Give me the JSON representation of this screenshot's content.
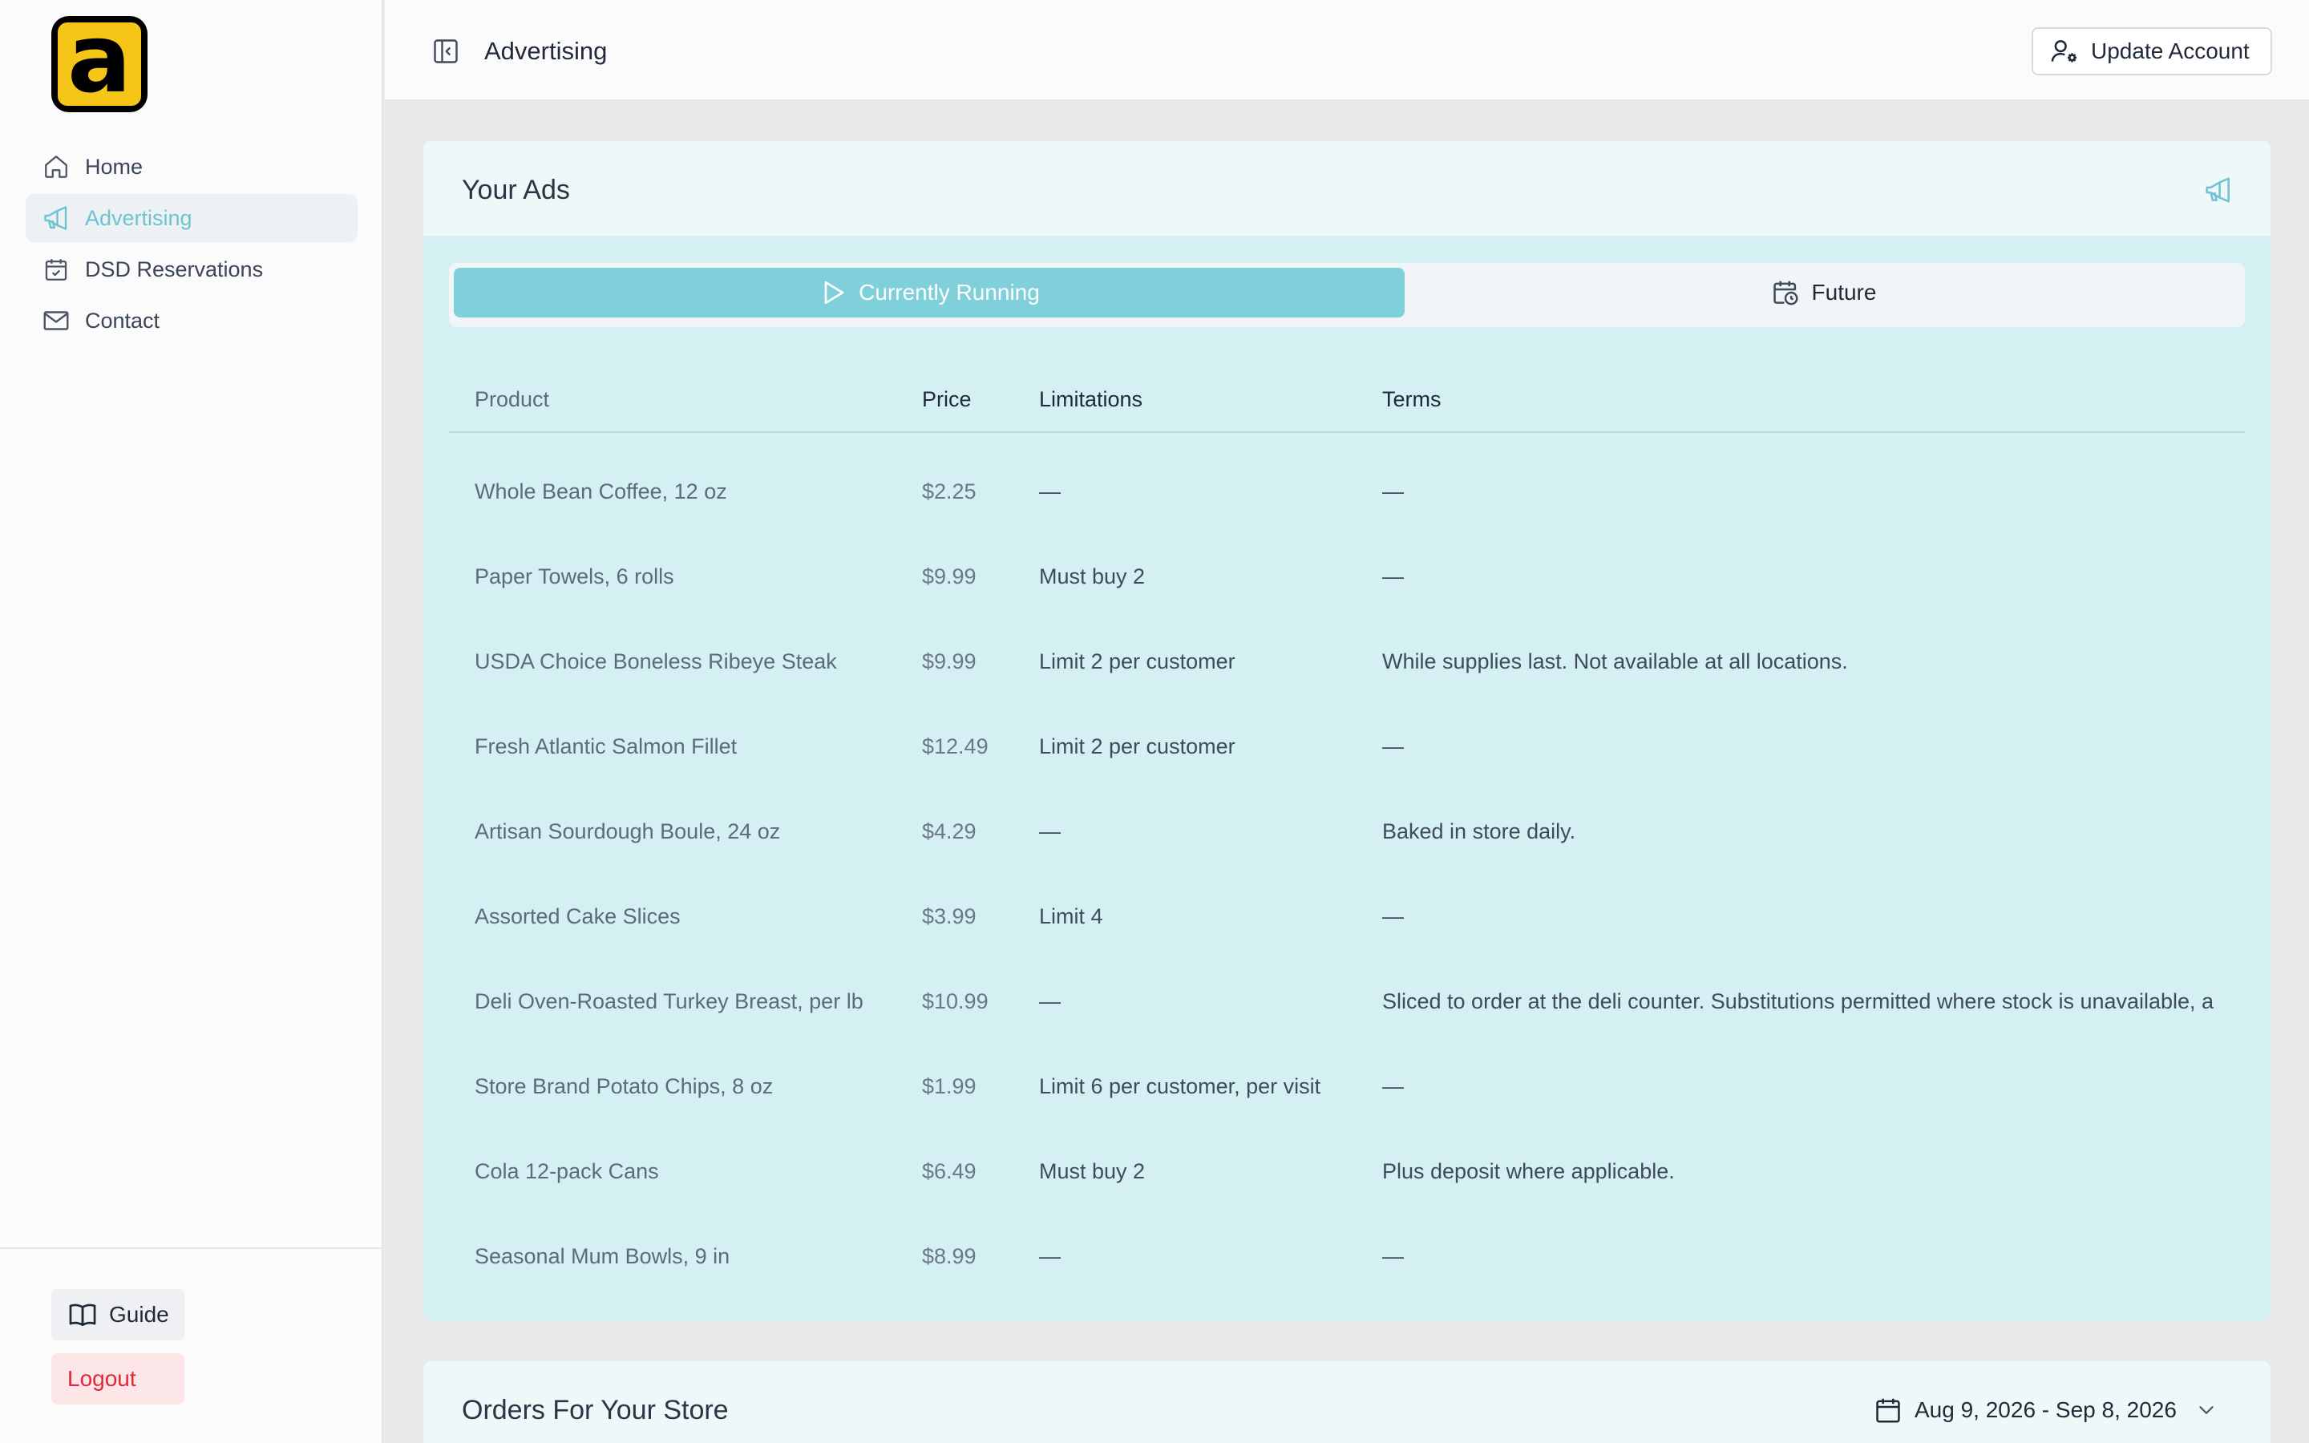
{
  "sidebar": {
    "logo_text": "a",
    "nav": [
      {
        "label": "Home",
        "icon": "home-icon"
      },
      {
        "label": "Advertising",
        "icon": "megaphone-icon",
        "active": true
      },
      {
        "label": "DSD Reservations",
        "icon": "calendar-check-icon"
      },
      {
        "label": "Contact",
        "icon": "mail-icon"
      }
    ],
    "guide_label": "Guide",
    "logout_label": "Logout"
  },
  "header": {
    "title": "Advertising",
    "update_account_label": "Update Account"
  },
  "ads": {
    "title": "Your Ads",
    "tabs": [
      {
        "label": "Currently Running",
        "selected": true
      },
      {
        "label": "Future",
        "selected": false
      }
    ],
    "columns": [
      "Product",
      "Price",
      "Limitations",
      "Terms"
    ],
    "rows": [
      {
        "product": "Whole Bean Coffee, 12 oz",
        "price": "$2.25",
        "limitations": "—",
        "terms": "—"
      },
      {
        "product": "Paper Towels, 6 rolls",
        "price": "$9.99",
        "limitations": "Must buy 2",
        "terms": "—"
      },
      {
        "product": "USDA Choice Boneless Ribeye Steak",
        "price": "$9.99",
        "limitations": "Limit 2 per customer",
        "terms": "While supplies last. Not available at all locations."
      },
      {
        "product": "Fresh Atlantic Salmon Fillet",
        "price": "$12.49",
        "limitations": "Limit 2 per customer",
        "terms": "—"
      },
      {
        "product": "Artisan Sourdough Boule, 24 oz",
        "price": "$4.29",
        "limitations": "—",
        "terms": "Baked in store daily."
      },
      {
        "product": "Assorted Cake Slices",
        "price": "$3.99",
        "limitations": "Limit 4",
        "terms": "—"
      },
      {
        "product": "Deli Oven-Roasted Turkey Breast, per lb",
        "price": "$10.99",
        "limitations": "—",
        "terms": "Sliced to order at the deli counter. Substitutions permitted where stock is unavailable, a"
      },
      {
        "product": "Store Brand Potato Chips, 8 oz",
        "price": "$1.99",
        "limitations": "Limit 6 per customer, per visit",
        "terms": "—"
      },
      {
        "product": "Cola 12-pack Cans",
        "price": "$6.49",
        "limitations": "Must buy 2",
        "terms": "Plus deposit where applicable."
      },
      {
        "product": "Seasonal Mum Bowls, 9 in",
        "price": "$8.99",
        "limitations": "—",
        "terms": "—"
      }
    ]
  },
  "orders": {
    "title": "Orders For Your Store",
    "date_range": "Aug 9, 2026 - Sep 8, 2026"
  },
  "colors": {
    "accent": "#80d0dc",
    "active_nav_text": "#6cc3d2",
    "card_bg": "#d5f0f3",
    "logout_text": "#e0283a",
    "logo_yellow": "#f5c518"
  }
}
